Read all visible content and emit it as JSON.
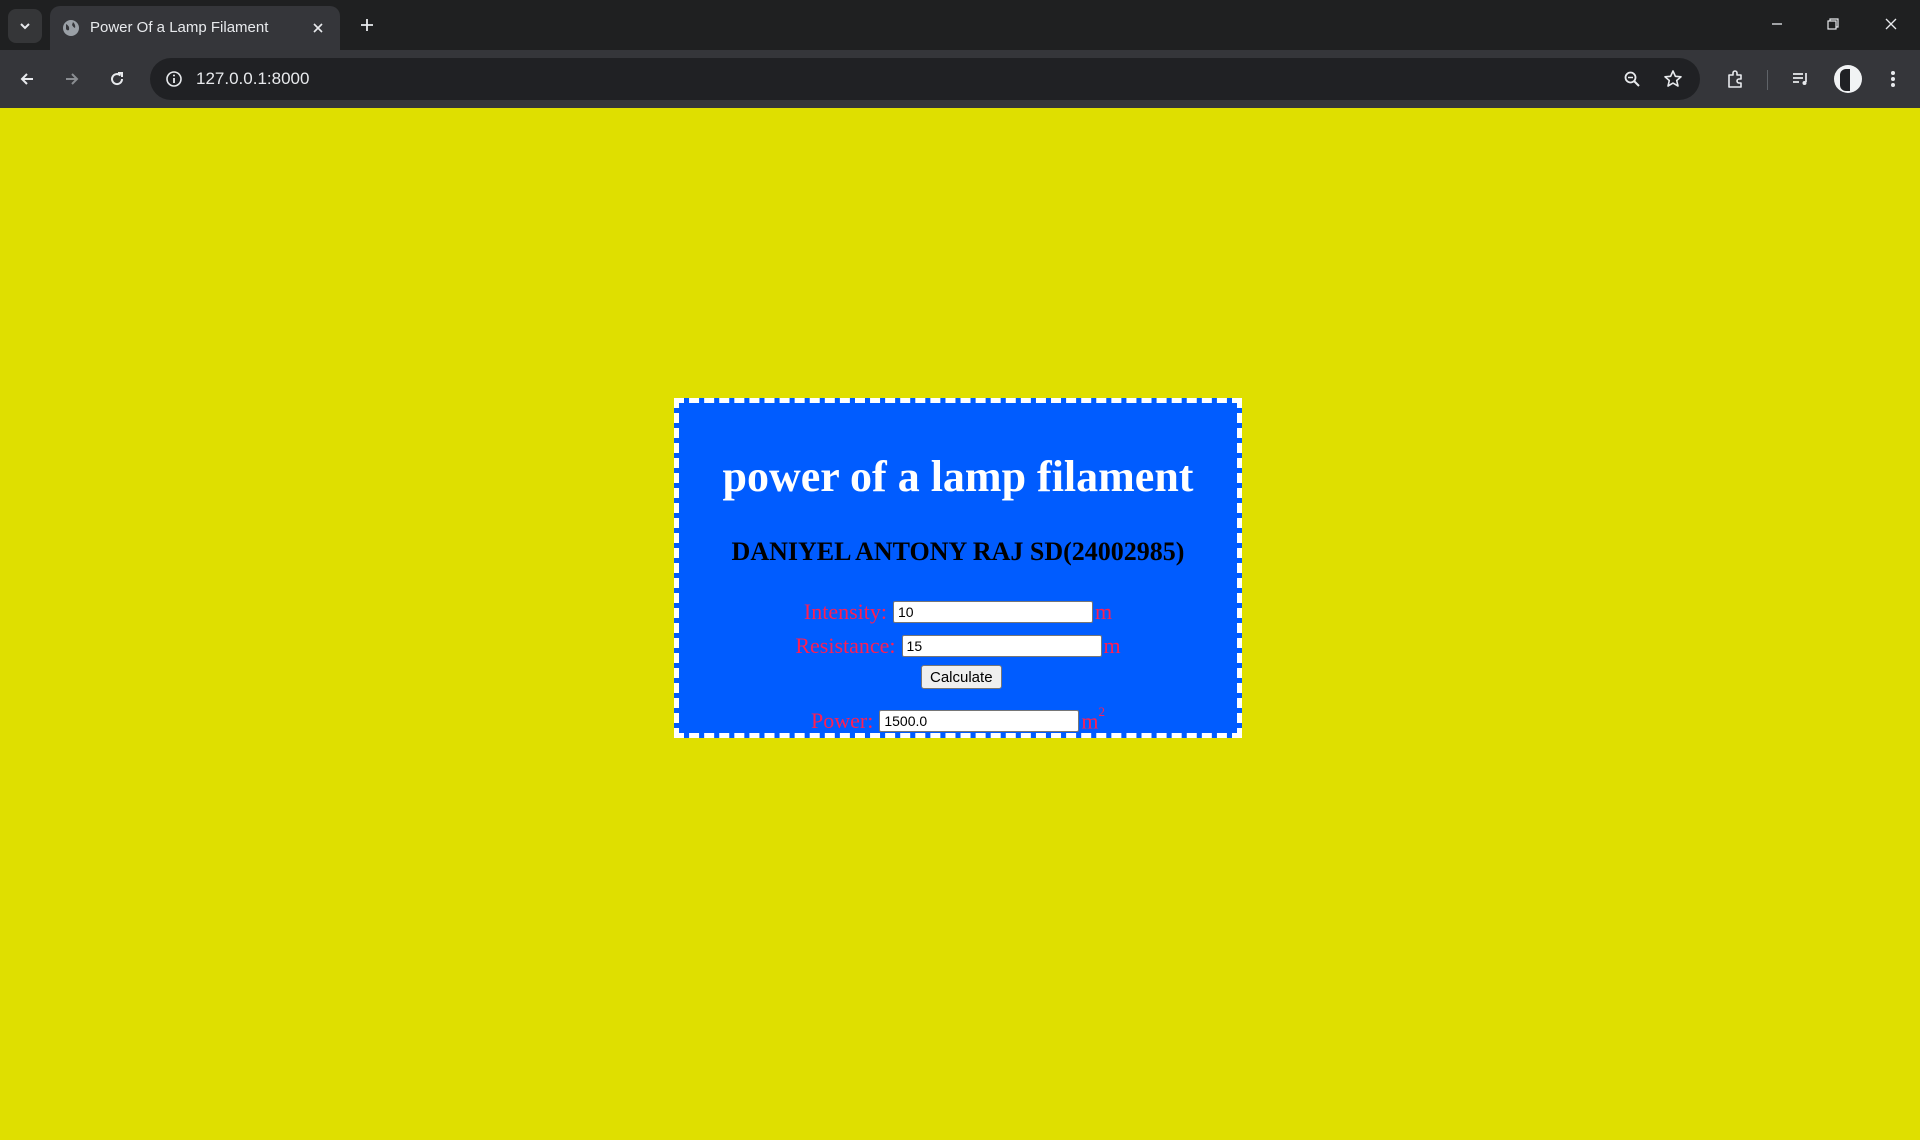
{
  "browser": {
    "tab": {
      "title": "Power Of a Lamp Filament"
    },
    "address_bar": {
      "url": "127.0.0.1:8000"
    }
  },
  "page": {
    "background_color": "#dfdf00",
    "card_color": "#005cff",
    "title": "power of a lamp filament",
    "subtitle": "DANIYEL ANTONY RAJ SD(24002985)",
    "form": {
      "intensity": {
        "label": "Intensity:",
        "value": "10",
        "unit": "m"
      },
      "resistance": {
        "label": "Resistance:",
        "value": "15",
        "unit": "m"
      },
      "calculate_label": "Calculate",
      "power": {
        "label": "Power:",
        "value": "1500.0",
        "unit": "m",
        "unit_exponent": "2"
      }
    }
  }
}
